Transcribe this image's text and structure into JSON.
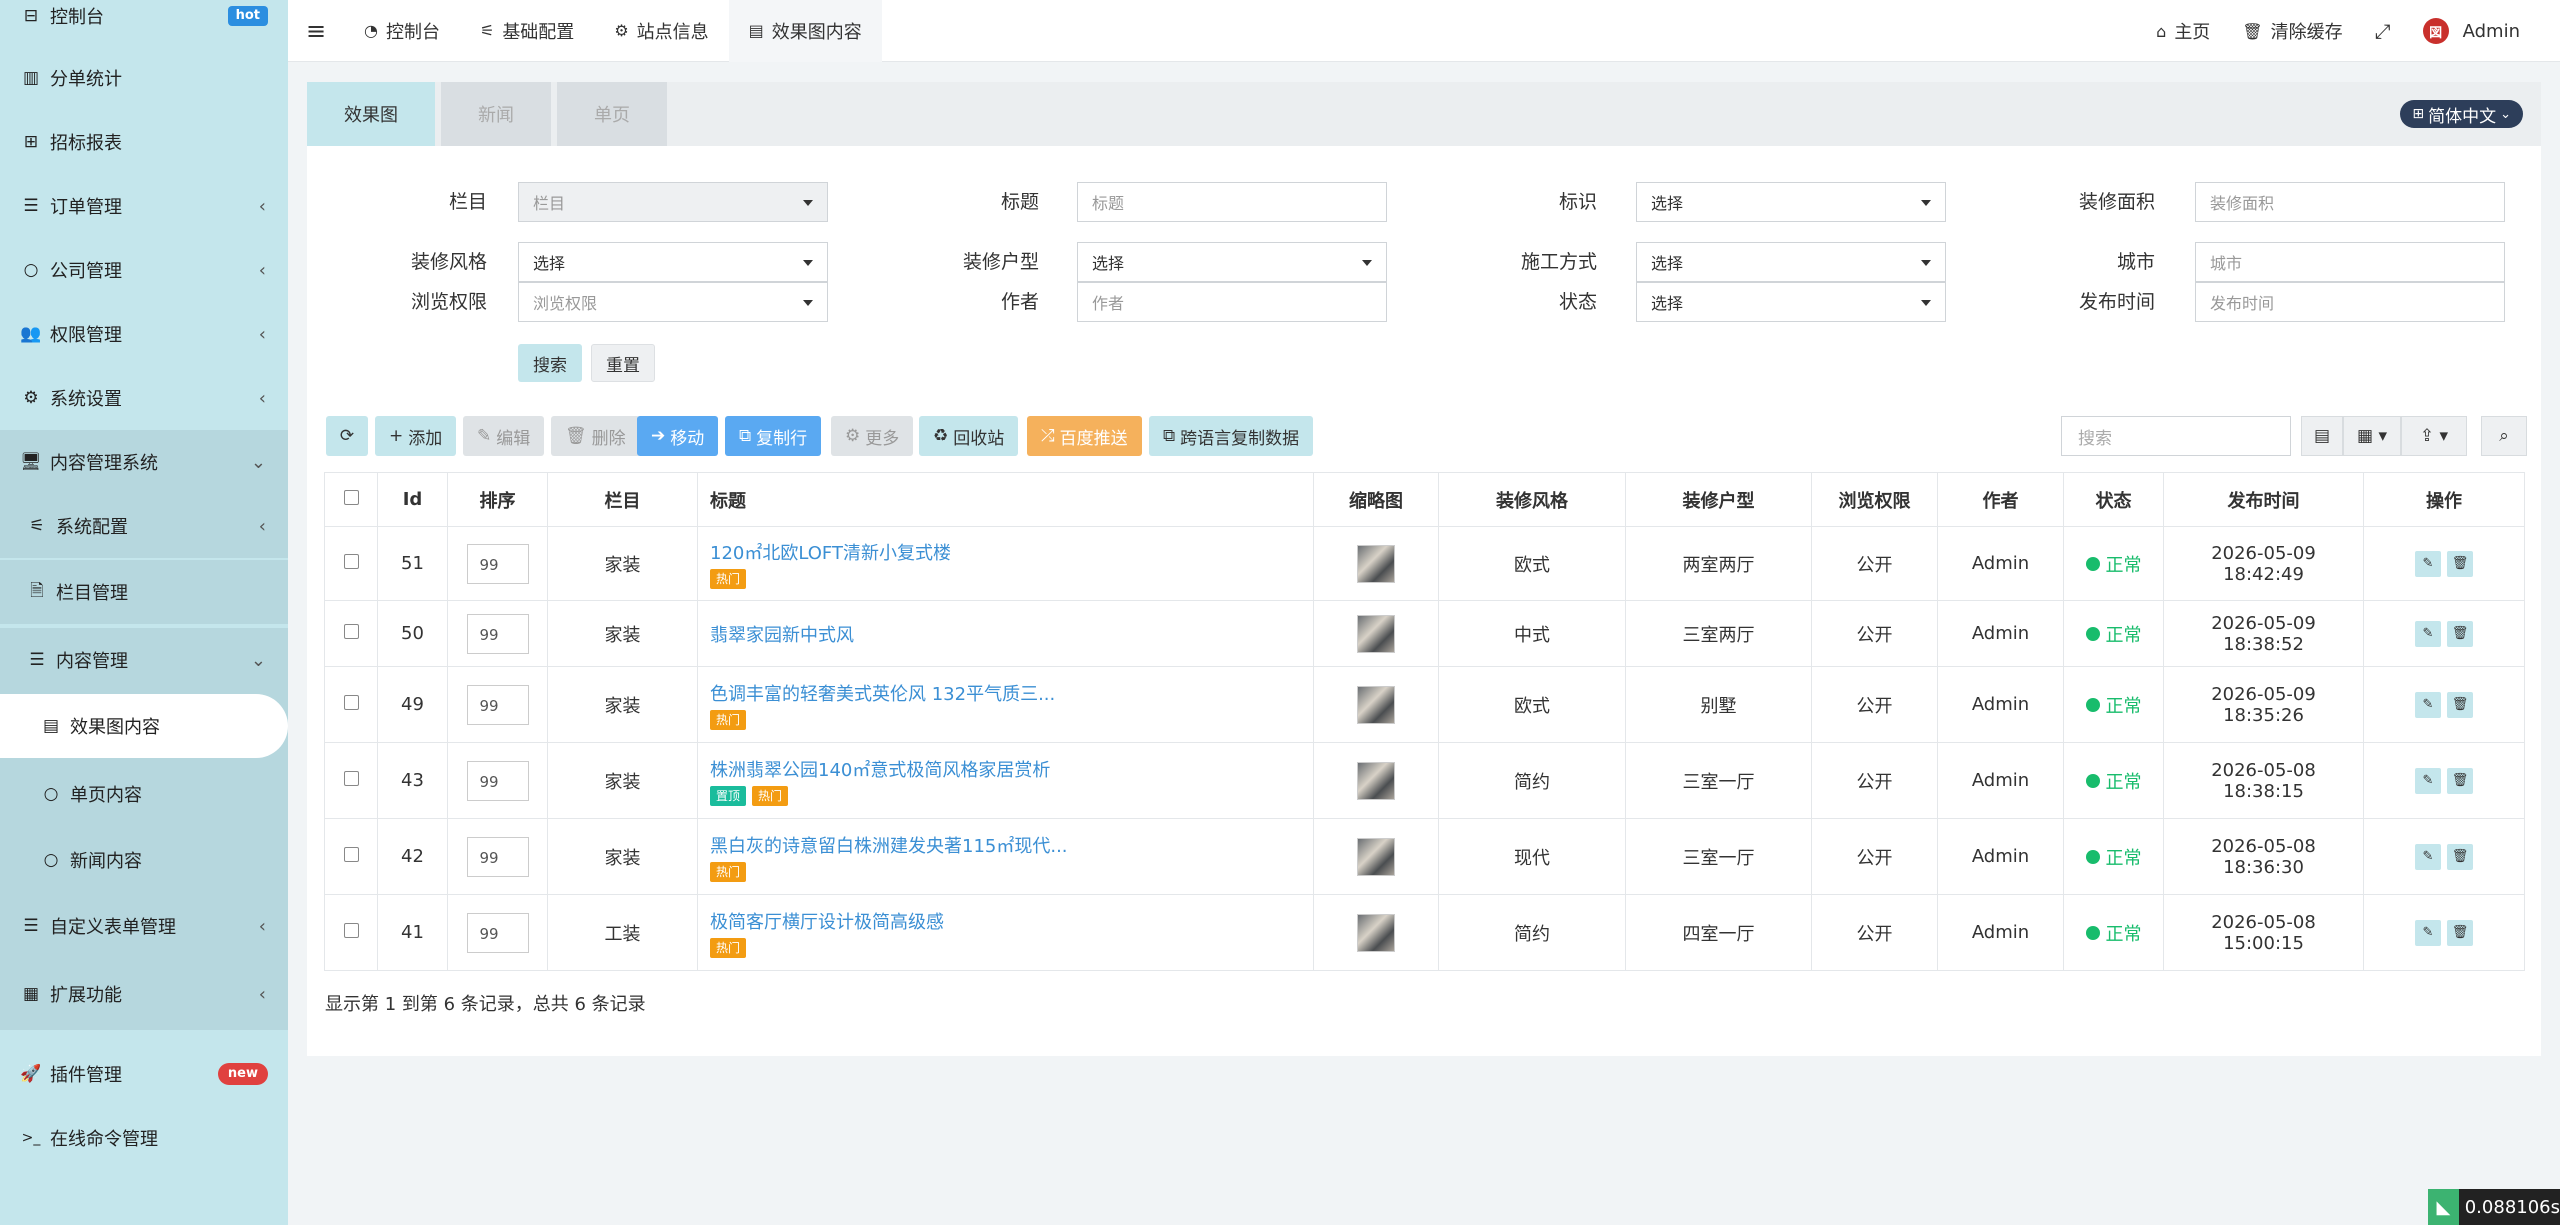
{
  "sidebar": {
    "items": [
      {
        "icon": "dashboard-icon",
        "glyph": "⊟",
        "label": "控制台",
        "badge": "hot"
      },
      {
        "icon": "bar-chart-icon",
        "glyph": "▥",
        "label": "分单统计"
      },
      {
        "icon": "table-icon",
        "glyph": "⊞",
        "label": "招标报表"
      },
      {
        "icon": "list-icon",
        "glyph": "☰",
        "label": "订单管理",
        "chevron": "‹"
      },
      {
        "icon": "circle-icon",
        "glyph": "○",
        "label": "公司管理",
        "chevron": "‹"
      },
      {
        "icon": "users-icon",
        "glyph": "👥",
        "label": "权限管理",
        "chevron": "‹"
      },
      {
        "icon": "gears-icon",
        "glyph": "⚙",
        "label": "系统设置",
        "chevron": "‹"
      },
      {
        "icon": "desktop-icon",
        "glyph": "🖥",
        "label": "内容管理系统",
        "chevron": "⌄"
      },
      {
        "icon": "sliders-icon",
        "glyph": "⚟",
        "label": "系统配置",
        "chevron": "‹"
      },
      {
        "icon": "file-icon",
        "glyph": "🗎",
        "label": "栏目管理"
      },
      {
        "icon": "list-icon",
        "glyph": "☰",
        "label": "内容管理",
        "chevron": "⌄"
      },
      {
        "icon": "list-alt-icon",
        "glyph": "▤",
        "label": "效果图内容"
      },
      {
        "icon": "circle-icon",
        "glyph": "○",
        "label": "单页内容"
      },
      {
        "icon": "circle-icon",
        "glyph": "○",
        "label": "新闻内容"
      },
      {
        "icon": "list-icon",
        "glyph": "☰",
        "label": "自定义表单管理",
        "chevron": "‹"
      },
      {
        "icon": "th-large-icon",
        "glyph": "▦",
        "label": "扩展功能",
        "chevron": "‹"
      },
      {
        "icon": "rocket-icon",
        "glyph": "🚀",
        "label": "插件管理",
        "badge": "new"
      },
      {
        "icon": "terminal-icon",
        "glyph": ">_",
        "label": "在线命令管理"
      }
    ]
  },
  "topbar": {
    "tabs": [
      {
        "icon": "dashboard-icon",
        "glyph": "◔",
        "label": "控制台"
      },
      {
        "icon": "sliders-icon",
        "glyph": "⚟",
        "label": "基础配置"
      },
      {
        "icon": "gear-icon",
        "glyph": "⚙",
        "label": "站点信息"
      },
      {
        "icon": "list-alt-icon",
        "glyph": "▤",
        "label": "效果图内容"
      }
    ],
    "right": {
      "home": "主页",
      "clear_cache": "清除缓存",
      "user": "Admin"
    }
  },
  "panel": {
    "tabs": [
      "效果图",
      "新闻",
      "单页"
    ],
    "lang": "简体中文"
  },
  "filters": [
    {
      "label": "栏目",
      "placeholder": "栏目",
      "type": "select-disabled"
    },
    {
      "label": "标题",
      "placeholder": "标题",
      "type": "input"
    },
    {
      "label": "标识",
      "placeholder": "选择",
      "type": "select"
    },
    {
      "label": "装修面积",
      "placeholder": "装修面积",
      "type": "input"
    },
    {
      "label": "装修风格",
      "placeholder": "选择",
      "type": "select"
    },
    {
      "label": "装修户型",
      "placeholder": "选择",
      "type": "select"
    },
    {
      "label": "施工方式",
      "placeholder": "选择",
      "type": "select"
    },
    {
      "label": "城市",
      "placeholder": "城市",
      "type": "input"
    },
    {
      "label": "浏览权限",
      "placeholder": "浏览权限",
      "type": "select"
    },
    {
      "label": "作者",
      "placeholder": "作者",
      "type": "input"
    },
    {
      "label": "状态",
      "placeholder": "选择",
      "type": "select"
    },
    {
      "label": "发布时间",
      "placeholder": "发布时间",
      "type": "input"
    }
  ],
  "form_buttons": {
    "search": "搜索",
    "reset": "重置"
  },
  "toolbar": {
    "add": "添加",
    "edit": "编辑",
    "delete": "删除",
    "move": "移动",
    "copy": "复制行",
    "more": "更多",
    "recycle": "回收站",
    "baidu": "百度推送",
    "cross_lang": "跨语言复制数据",
    "search_placeholder": "搜索"
  },
  "table": {
    "headers": [
      "Id",
      "排序",
      "栏目",
      "标题",
      "缩略图",
      "装修风格",
      "装修户型",
      "浏览权限",
      "作者",
      "状态",
      "发布时间",
      "操作"
    ],
    "rows": [
      {
        "id": "51",
        "sort": "99",
        "cat": "家装",
        "title": "120㎡北欧LOFT清新小复式楼",
        "tags": [
          "热门"
        ],
        "style": "欧式",
        "type": "两室两厅",
        "perm": "公开",
        "author": "Admin",
        "status": "正常",
        "time": "2026-05-09 18:42:49"
      },
      {
        "id": "50",
        "sort": "99",
        "cat": "家装",
        "title": "翡翠家园新中式风",
        "tags": [],
        "style": "中式",
        "type": "三室两厅",
        "perm": "公开",
        "author": "Admin",
        "status": "正常",
        "time": "2026-05-09 18:38:52"
      },
      {
        "id": "49",
        "sort": "99",
        "cat": "家装",
        "title": "色调丰富的轻奢美式英伦风 132平气质三...",
        "tags": [
          "热门"
        ],
        "style": "欧式",
        "type": "别墅",
        "perm": "公开",
        "author": "Admin",
        "status": "正常",
        "time": "2026-05-09 18:35:26"
      },
      {
        "id": "43",
        "sort": "99",
        "cat": "家装",
        "title": "株洲翡翠公园140㎡意式极简风格家居赏析",
        "tags": [
          "置顶",
          "热门"
        ],
        "style": "简约",
        "type": "三室一厅",
        "perm": "公开",
        "author": "Admin",
        "status": "正常",
        "time": "2026-05-08 18:38:15"
      },
      {
        "id": "42",
        "sort": "99",
        "cat": "家装",
        "title": "黑白灰的诗意留白株洲建发央著115㎡现代...",
        "tags": [
          "热门"
        ],
        "style": "现代",
        "type": "三室一厅",
        "perm": "公开",
        "author": "Admin",
        "status": "正常",
        "time": "2026-05-08 18:36:30"
      },
      {
        "id": "41",
        "sort": "99",
        "cat": "工装",
        "title": "极简客厅横厅设计极简高级感",
        "tags": [
          "热门"
        ],
        "style": "简约",
        "type": "四室一厅",
        "perm": "公开",
        "author": "Admin",
        "status": "正常",
        "time": "2026-05-08 15:00:15"
      }
    ]
  },
  "summary": "显示第 1 到第 6 条记录，总共 6 条记录",
  "timer": "0.088106s"
}
